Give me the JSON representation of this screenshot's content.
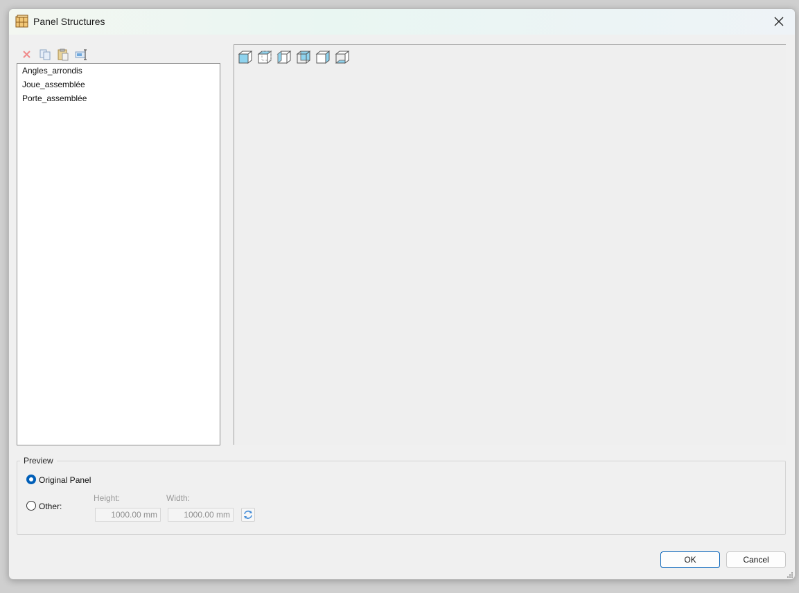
{
  "window": {
    "title": "Panel Structures"
  },
  "list": {
    "items": [
      {
        "label": "Angles_arrondis"
      },
      {
        "label": "Joue_assemblée"
      },
      {
        "label": "Porte_assemblée"
      }
    ]
  },
  "toolbar": {
    "icons": [
      "delete-icon",
      "copy-icon",
      "paste-icon",
      "rename-icon"
    ]
  },
  "preview_views": {
    "icons": [
      "view-front-icon",
      "view-top-icon",
      "view-left-icon",
      "view-back-icon",
      "view-right-icon",
      "view-bottom-icon"
    ]
  },
  "preview_group": {
    "label": "Preview",
    "original_label": "Original Panel",
    "original_checked": true,
    "other_label": "Other:",
    "other_checked": false,
    "height_label": "Height:",
    "height_value": "1000.00 mm",
    "width_label": "Width:",
    "width_value": "1000.00 mm"
  },
  "buttons": {
    "ok": "OK",
    "cancel": "Cancel"
  },
  "colors": {
    "accent": "#005fb8",
    "cube_face": "#8fd3ee"
  }
}
